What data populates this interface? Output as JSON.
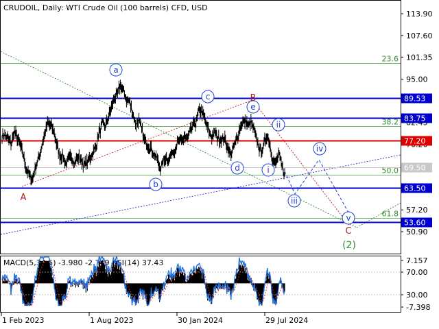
{
  "header": {
    "title": "CRUDOIL, Daily:  WTI Crude Oil (100 barrels) CFD, USD"
  },
  "price_axis": {
    "ticks": [
      "113.90",
      "107.60",
      "101.35",
      "95.00",
      "82.45",
      "76.20",
      "63.90",
      "57.20",
      "50.90"
    ]
  },
  "level_lines": [
    {
      "label": "89.53",
      "value": 89.53,
      "color": "#0000cc",
      "kind": "horizontal"
    },
    {
      "label": "83.75",
      "value": 83.75,
      "color": "#0000cc",
      "kind": "horizontal"
    },
    {
      "label": "77.20",
      "value": 77.2,
      "color": "#dd0000",
      "kind": "horizontal"
    },
    {
      "label": "69.50",
      "value": 69.5,
      "color": "#c8c8c8",
      "kind": "horizontal"
    },
    {
      "label": "63.50",
      "value": 63.5,
      "color": "#0000cc",
      "kind": "horizontal"
    },
    {
      "label": "53.60",
      "value": 53.6,
      "color": "#0000cc",
      "kind": "horizontal"
    }
  ],
  "fib_levels": [
    {
      "label": "23.6",
      "value": 99.6
    },
    {
      "label": "38.2",
      "value": 81.4
    },
    {
      "label": "50.0",
      "value": 67.3
    },
    {
      "label": "61.8",
      "value": 54.8
    }
  ],
  "wave_labels": {
    "a": "a",
    "b": "b",
    "c": "c",
    "d": "d",
    "e": "e",
    "i": "i",
    "ii": "ii",
    "iii": "iii",
    "iv": "iv",
    "v": "v",
    "A": "A",
    "B": "B",
    "C": "C",
    "w2": "(2)"
  },
  "indicator": {
    "label": "MACD(5,34,5) -3.980 -2.749 RSI(14) 37.43",
    "ticks": [
      "7.157",
      "70.00",
      "30.00",
      "-7.398"
    ]
  },
  "time_axis": {
    "labels": [
      "1 Feb 2023",
      "1 Aug 2023",
      "30 Jan 2024",
      "29 Jul 2024"
    ]
  },
  "chart_data": {
    "type": "line",
    "series": [
      {
        "values": [
          78.5,
          79.0,
          77.5,
          76.0,
          80.0,
          78.0,
          75.5,
          73.0,
          69.0,
          67.0,
          66.0,
          69.5,
          72.0,
          75.5,
          79.0,
          82.0,
          81.5,
          80.0,
          76.0,
          72.5,
          73.0,
          70.5,
          72.0,
          72.5,
          71.0,
          72.5,
          71.5,
          70.0,
          71.0,
          72.5,
          73.5,
          76.0,
          79.5,
          82.0,
          81.5,
          84.0,
          87.0,
          89.5,
          90.5,
          93.5,
          91.5,
          89.0,
          88.5,
          85.0,
          82.0,
          83.0,
          80.0,
          77.0,
          76.0,
          75.0,
          73.5,
          72.0,
          69.0,
          71.0,
          72.5,
          71.5,
          74.0,
          75.0,
          77.0,
          76.5,
          78.5,
          77.5,
          80.0,
          81.5,
          83.0,
          86.5,
          85.0,
          82.5,
          80.0,
          78.5,
          79.5,
          78.0,
          77.5,
          78.0,
          76.0,
          73.5,
          74.5,
          77.0,
          80.0,
          82.0,
          83.0,
          81.5,
          82.5,
          80.0,
          77.0,
          74.0,
          75.0,
          79.0,
          77.0,
          72.0,
          70.0,
          73.5,
          70.0,
          67.5
        ]
      }
    ],
    "x_range": [
      "2022-12-01",
      "2025-01-15"
    ],
    "ylim": [
      45.0,
      117.5
    ]
  }
}
